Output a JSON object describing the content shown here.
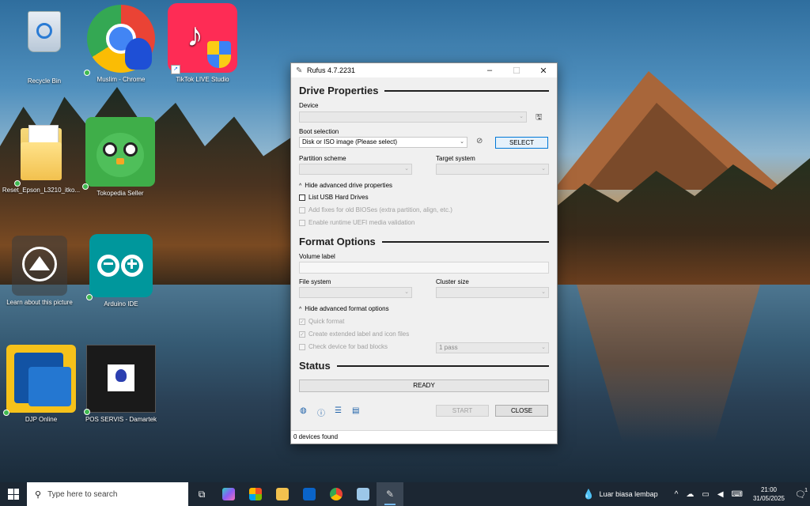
{
  "desktop": {
    "icons": [
      {
        "label": "Recycle Bin",
        "icon": "recycle-bin-icon"
      },
      {
        "label": "Muslim - Chrome",
        "icon": "chrome-profile-icon"
      },
      {
        "label": "TikTok LIVE Studio",
        "icon": "tiktok-icon"
      },
      {
        "label": "Reset_Epson_L3210_itko...",
        "icon": "folder-icon"
      },
      {
        "label": "Tokopedia Seller",
        "icon": "tokopedia-icon"
      },
      {
        "label": "Learn about this picture",
        "icon": "camera-icon"
      },
      {
        "label": "Arduino IDE",
        "icon": "arduino-icon"
      },
      {
        "label": "DJP Online",
        "icon": "djp-icon"
      },
      {
        "label": "POS SERVIS - Damartek",
        "icon": "pos-servis-icon"
      }
    ]
  },
  "rufus": {
    "title": "Rufus 4.7.2231",
    "drive_properties": {
      "heading": "Drive Properties",
      "device_label": "Device",
      "device_value": "",
      "boot_selection_label": "Boot selection",
      "boot_selection_value": "Disk or ISO image (Please select)",
      "select_button": "SELECT",
      "partition_scheme_label": "Partition scheme",
      "target_system_label": "Target system",
      "advanced_toggle": "Hide advanced drive properties",
      "list_usb": "List USB Hard Drives",
      "add_fixes": "Add fixes for old BIOSes (extra partition, align, etc.)",
      "uefi_validation": "Enable runtime UEFI media validation"
    },
    "format_options": {
      "heading": "Format Options",
      "volume_label_label": "Volume label",
      "file_system_label": "File system",
      "cluster_size_label": "Cluster size",
      "advanced_toggle": "Hide advanced format options",
      "quick_format": "Quick format",
      "extended_label": "Create extended label and icon files",
      "bad_blocks": "Check device for bad blocks",
      "passes_value": "1 pass"
    },
    "status": {
      "heading": "Status",
      "progress_text": "READY",
      "start_button": "START",
      "close_button": "CLOSE"
    },
    "statusbar": "0 devices found"
  },
  "taskbar": {
    "search_placeholder": "Type here to search",
    "weather": "Luar biasa lembap",
    "time": "21:00",
    "date": "31/05/2025",
    "notification_count": "1"
  }
}
